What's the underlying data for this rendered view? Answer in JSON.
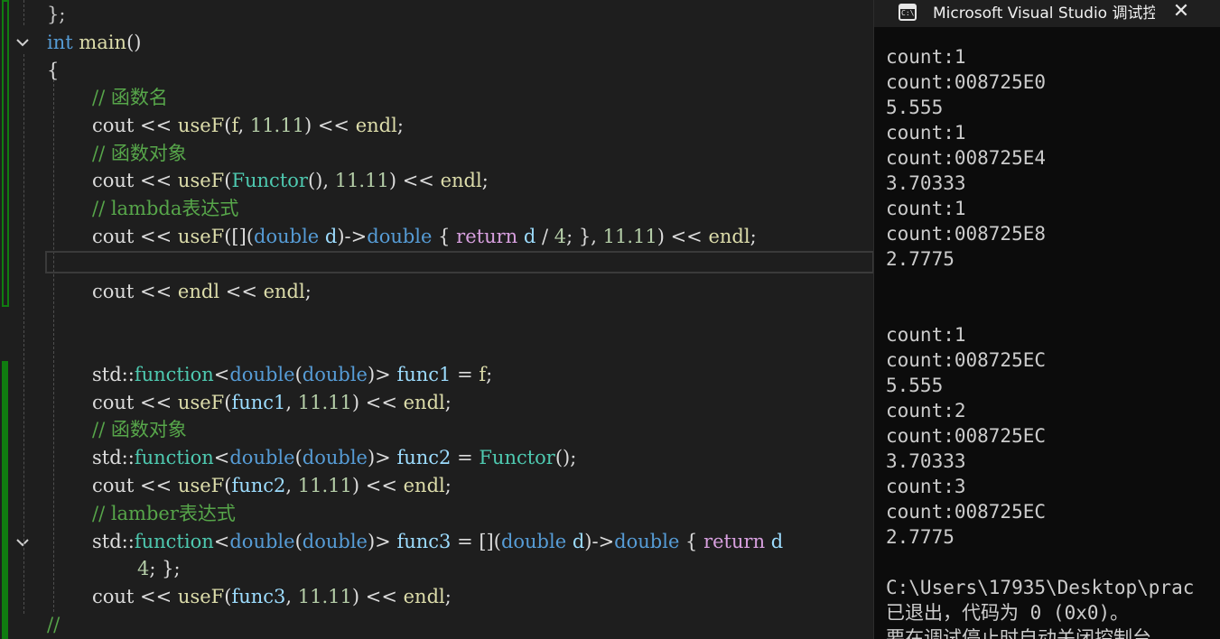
{
  "editor": {
    "lines": {
      "l0": [
        "};"
      ],
      "l1": [
        "int",
        " ",
        "main",
        "()"
      ],
      "l2": [
        "{"
      ],
      "l3": [
        "// 函数名"
      ],
      "l4": [
        "cout",
        " << ",
        "useF",
        "(",
        "f",
        ", ",
        "11.11",
        ") << ",
        "endl",
        ";"
      ],
      "l5": [
        "// 函数对象"
      ],
      "l6": [
        "cout",
        " << ",
        "useF",
        "(",
        "Functor",
        "(), ",
        "11.11",
        ") << ",
        "endl",
        ";"
      ],
      "l7": [
        "// lambda表达式"
      ],
      "l8": [
        "cout",
        " << ",
        "useF",
        "([](",
        "double",
        " ",
        "d",
        ")->",
        "double",
        " { ",
        "return",
        " ",
        "d",
        " / ",
        "4",
        "; }, ",
        "11.11",
        ") << ",
        "endl",
        ";"
      ],
      "l10": [
        "cout",
        " << ",
        "endl",
        " << ",
        "endl",
        ";"
      ],
      "l13": [
        "std",
        "::",
        "function",
        "<",
        "double",
        "(",
        "double",
        ")> ",
        "func1",
        " = ",
        "f",
        ";"
      ],
      "l14": [
        "cout",
        " << ",
        "useF",
        "(",
        "func1",
        ", ",
        "11.11",
        ") << ",
        "endl",
        ";"
      ],
      "l15": [
        "// 函数对象"
      ],
      "l16": [
        "std",
        "::",
        "function",
        "<",
        "double",
        "(",
        "double",
        ")> ",
        "func2",
        " = ",
        "Functor",
        "();"
      ],
      "l17": [
        "cout",
        " << ",
        "useF",
        "(",
        "func2",
        ", ",
        "11.11",
        ") << ",
        "endl",
        ";"
      ],
      "l18": [
        "// lamber表达式"
      ],
      "l19": [
        "std",
        "::",
        "function",
        "<",
        "double",
        "(",
        "double",
        ")> ",
        "func3",
        " = ",
        "[](",
        "double",
        " ",
        "d",
        ")->",
        "double",
        " { ",
        "return",
        " ",
        "d"
      ],
      "l20": [
        "4",
        "; };"
      ],
      "l21": [
        "cout",
        " << ",
        "useF",
        "(",
        "func3",
        ", ",
        "11.11",
        ") << ",
        "endl",
        ";"
      ],
      "l22": [
        "//"
      ]
    }
  },
  "console": {
    "title": "Microsoft Visual Studio 调试控制台",
    "icon_label": "C:\\",
    "close_label": "✕",
    "output": [
      "count:1",
      "count:008725E0",
      "5.555",
      "count:1",
      "count:008725E4",
      "3.70333",
      "count:1",
      "count:008725E8",
      "2.7775",
      "",
      "",
      "count:1",
      "count:008725EC",
      "5.555",
      "count:2",
      "count:008725EC",
      "3.70333",
      "count:3",
      "count:008725EC",
      "2.7775",
      "",
      "C:\\Users\\17935\\Desktop\\prac",
      "已退出，代码为 0 (0x0)。",
      "要在调试停止时自动关闭控制台"
    ]
  },
  "colors": {
    "editor_bg": "#1e1e1e",
    "console_bg": "#0c0c0c",
    "keyword": "#569cd6",
    "type": "#4ec9b0",
    "function": "#dcdcaa",
    "variable": "#9cdcfe",
    "number": "#b5cea8",
    "comment": "#57a64a",
    "control": "#d8a0df",
    "change_saved": "#107c10"
  }
}
